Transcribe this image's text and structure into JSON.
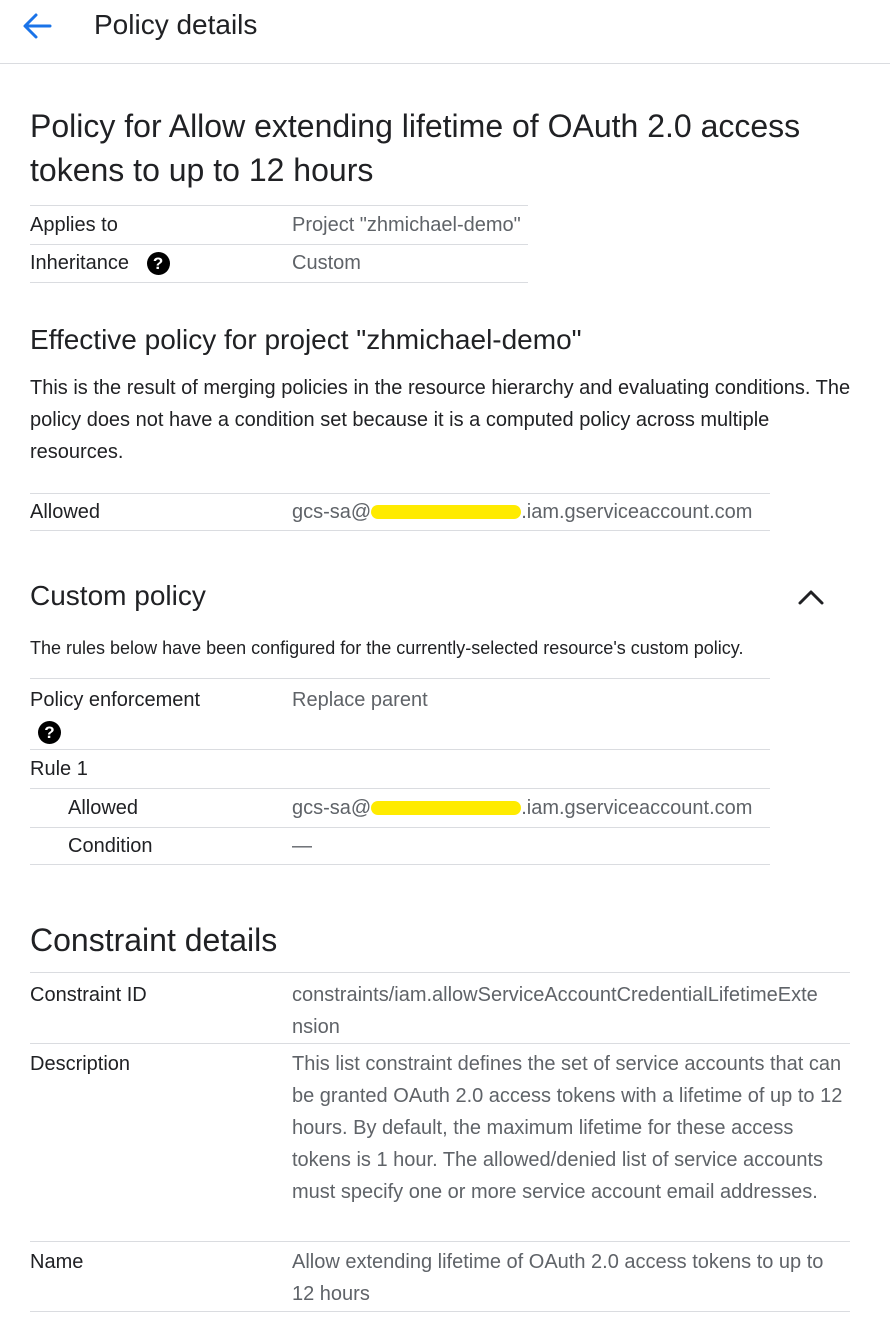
{
  "header": {
    "title": "Policy details",
    "back_icon": "arrow-back-icon",
    "accent": "#1a73e8"
  },
  "policy": {
    "title": "Policy for Allow extending lifetime of OAuth 2.0 access tokens to up to 12 hours",
    "applies_to_label": "Applies to",
    "applies_to_value": "Project \"zhmichael-demo\"",
    "inheritance_label": "Inheritance",
    "inheritance_value": "Custom",
    "help_icon": "help-icon"
  },
  "effective": {
    "title": "Effective policy for project \"zhmichael-demo\"",
    "description": "This is the result of merging policies in the resource hierarchy and evaluating conditions. The policy does not have a condition set because it is a computed policy across multiple resources.",
    "allowed_label": "Allowed",
    "allowed_prefix": "gcs-sa@",
    "allowed_suffix": ".iam.gserviceaccount.com"
  },
  "custom": {
    "title": "Custom policy",
    "collapse_icon": "chevron-up-icon",
    "description": "The rules below have been configured for the currently-selected resource's custom policy.",
    "enforcement_label": "Policy enforcement",
    "enforcement_value": "Replace parent",
    "rule_label": "Rule 1",
    "allowed_label": "Allowed",
    "allowed_prefix": "gcs-sa@",
    "allowed_suffix": ".iam.gserviceaccount.com",
    "condition_label": "Condition",
    "condition_value": "—"
  },
  "constraint": {
    "title": "Constraint details",
    "id_label": "Constraint ID",
    "id_value_line1": "constraints/iam.allowServiceAccountCredentialLifetimeExte",
    "id_value_line2": "nsion",
    "description_label": "Description",
    "description_value": "This list constraint defines the set of service accounts that can be granted OAuth 2.0 access tokens with a lifetime of up to 12 hours. By default, the maximum lifetime for these access tokens is 1 hour. The allowed/denied list of service accounts must specify one or more service account email addresses.",
    "name_label": "Name",
    "name_value": "Allow extending lifetime of OAuth 2.0 access tokens to up to 12 hours"
  },
  "colors": {
    "redaction": "#ffeb00",
    "divider": "#dadce0",
    "secondary_text": "#5f6368"
  }
}
